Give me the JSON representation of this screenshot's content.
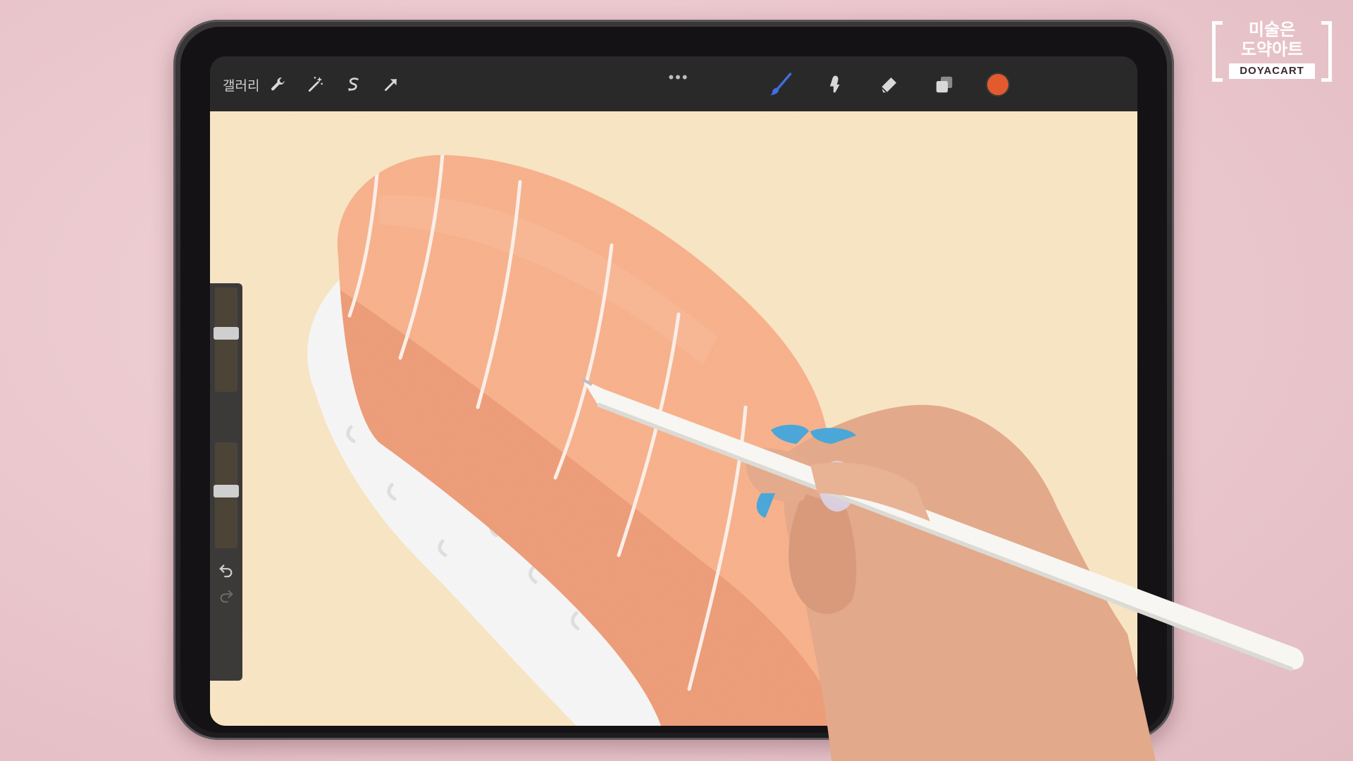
{
  "watermark": {
    "line1": "미술은",
    "line2": "도약아트",
    "brand": "DOYACART"
  },
  "toolbar": {
    "gallery_label": "갤러리",
    "left_icons": [
      "wrench-icon",
      "magic-wand-icon",
      "selection-icon",
      "transform-arrow-icon"
    ],
    "more_label": "•••",
    "right_icons": [
      "brush-icon",
      "smudge-icon",
      "eraser-icon",
      "layers-icon"
    ],
    "current_color": "#e35a2f",
    "active_tool": "brush"
  },
  "sidebar": {
    "icons": [
      "modify-square-icon",
      "undo-icon",
      "redo-icon"
    ]
  },
  "colors": {
    "canvas_bg": "#f6d9a6",
    "salmon": "#f0824a",
    "salmon_dark": "#e66a36",
    "rice": "#f3f3f4"
  }
}
